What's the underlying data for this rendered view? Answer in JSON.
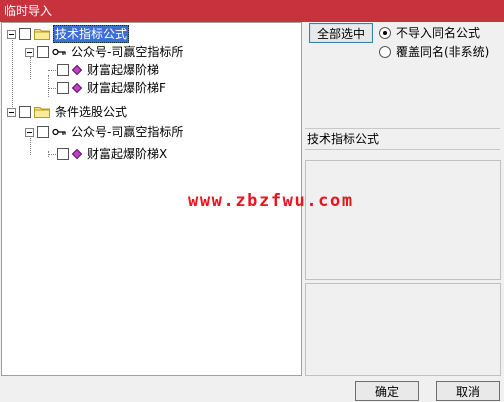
{
  "window": {
    "title": "临时导入"
  },
  "tree": {
    "groups": [
      {
        "label": "技术指标公式",
        "selected": true,
        "author": "公众号-司赢空指标所",
        "items": [
          "财富起爆阶梯",
          "财富起爆阶梯F"
        ]
      },
      {
        "label": "条件选股公式",
        "selected": false,
        "author": "公众号-司赢空指标所",
        "items": [
          "财富起爆阶梯X"
        ]
      }
    ]
  },
  "actions": {
    "select_all": "全部选中",
    "ok": "确定",
    "cancel": "取消"
  },
  "options": {
    "no_import_same_name": "不导入同名公式",
    "overwrite_same_name": "覆盖同名(非系统)",
    "selected": "no_import_same_name"
  },
  "info": {
    "category_label": "技术指标公式"
  },
  "watermark": "www.zbzfwu.com",
  "colors": {
    "titlebar": "#c7323c",
    "selection": "#3b6ed6",
    "watermark": "#e8141e"
  }
}
